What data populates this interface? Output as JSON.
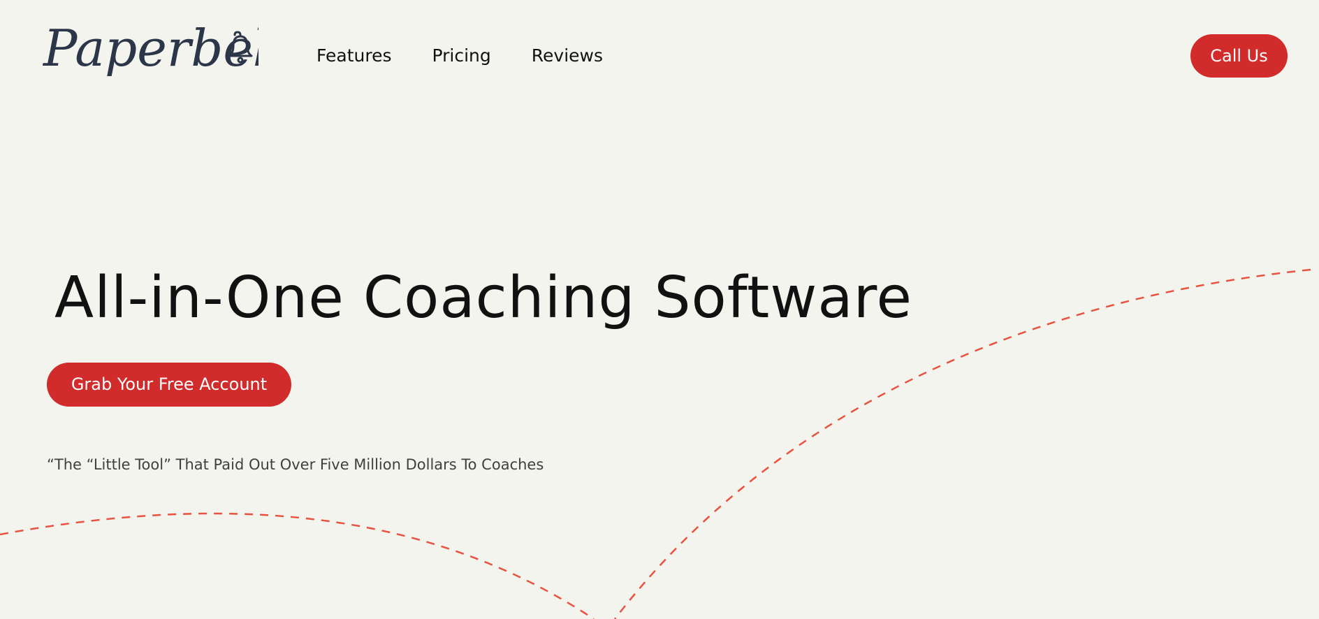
{
  "header": {
    "logo_text": "Paperbell",
    "logo_icon": "bell-icon",
    "nav": [
      {
        "label": "Features"
      },
      {
        "label": "Pricing"
      },
      {
        "label": "Reviews"
      }
    ],
    "call_button_label": "Call Us"
  },
  "hero": {
    "title": "All-in-One Coaching Software",
    "cta_label": "Grab Your Free Account",
    "tagline": "“The “Little Tool” That Paid Out Over Five Million Dollars To Coaches"
  },
  "colors": {
    "background": "#f4f4ef",
    "accent": "#d12b2b",
    "logo": "#2c3649",
    "text": "#111111",
    "tagline": "#3f3f3f",
    "decor_dash": "#e8523f"
  }
}
